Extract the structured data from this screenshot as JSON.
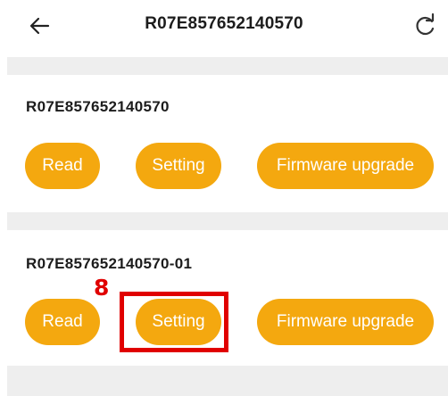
{
  "header": {
    "title": "R07E857652140570",
    "back_icon": "arrow-left-icon",
    "refresh_icon": "refresh-icon"
  },
  "devices": [
    {
      "id": "R07E857652140570",
      "buttons": {
        "read": "Read",
        "setting": "Setting",
        "firmware": "Firmware upgrade"
      }
    },
    {
      "id": "R07E857652140570-01",
      "buttons": {
        "read": "Read",
        "setting": "Setting",
        "firmware": "Firmware upgrade"
      }
    }
  ],
  "annotation": {
    "step_number": "8"
  },
  "colors": {
    "button_bg": "#f4a80f",
    "highlight": "#e00000",
    "separator": "#eeeeee"
  }
}
